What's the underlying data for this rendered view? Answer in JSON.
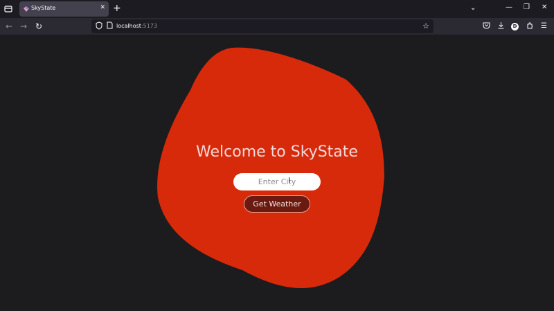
{
  "browser": {
    "tab": {
      "title": "SkyState",
      "close": "✕"
    },
    "new_tab": "+",
    "url": {
      "host": "localhost",
      "port": ":5173"
    },
    "icons": [
      "tab-list-icon",
      "back-icon",
      "forward-icon",
      "reload-icon",
      "shield-icon",
      "page-icon",
      "star-icon",
      "pocket-icon",
      "download-icon",
      "account-icon",
      "extensions-icon",
      "menu-icon"
    ],
    "account_initial": "D"
  },
  "app": {
    "title": "Welcome to SkyState",
    "city_input": {
      "placeholder": "Enter City",
      "value": ""
    },
    "button_label": "Get Weather",
    "colors": {
      "background": "#1c1b1d",
      "blob": "#d72a0b",
      "button": "#6a1a10"
    }
  }
}
